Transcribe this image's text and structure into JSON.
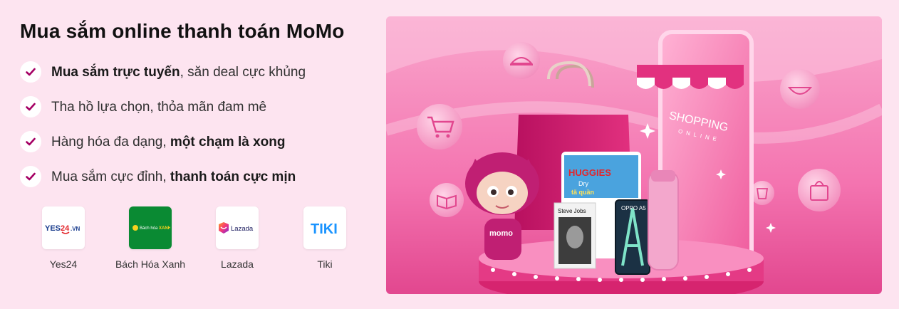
{
  "title": "Mua sắm online thanh toán MoMo",
  "features": [
    {
      "bold_first": "Mua sắm trực tuyến",
      "rest": ", săn deal cực khủng"
    },
    {
      "plain": "Tha hồ lựa chọn, thỏa mãn đam mê"
    },
    {
      "lead": "Hàng hóa đa dạng, ",
      "bold": "một chạm là xong"
    },
    {
      "lead": "Mua sắm cực đỉnh, ",
      "bold": "thanh toán cực mịn"
    }
  ],
  "partners": [
    {
      "name": "Yes24",
      "logo_text": "YES24.VN"
    },
    {
      "name": "Bách Hóa Xanh",
      "logo_text": "Bách hóa XANH"
    },
    {
      "name": "Lazada",
      "logo_text": "Lazada"
    },
    {
      "name": "Tiki",
      "logo_text": "TIKI"
    }
  ],
  "banner": {
    "phone_text_1": "SHOPPING",
    "phone_text_2": "ONLINE",
    "mascot_text": "momo",
    "diaper_text_1": "HUGGIES",
    "diaper_text_2": "Dry",
    "diaper_text_3": "tã quần",
    "book_text": "Steve Jobs",
    "phone_model_text": "OPPO A5",
    "phone_model_letter": "A"
  },
  "colors": {
    "check": "#a50064",
    "banner_bg": "#f36fae",
    "accent": "#d4257a"
  },
  "icons": [
    "check-icon",
    "food-icon",
    "cart-icon",
    "bowl-icon",
    "book-icon",
    "bag-icon",
    "drink-icon"
  ]
}
